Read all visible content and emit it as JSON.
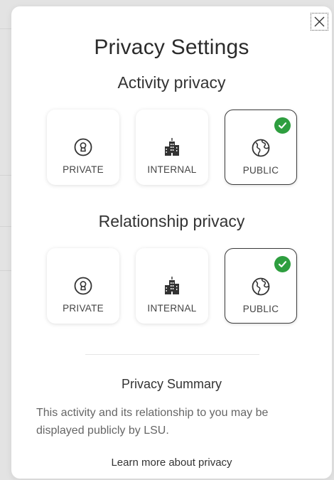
{
  "modal": {
    "title": "Privacy Settings"
  },
  "activity": {
    "heading": "Activity privacy",
    "options": [
      {
        "label": "PRIVATE",
        "icon": "keyhole-icon",
        "selected": false
      },
      {
        "label": "INTERNAL",
        "icon": "building-icon",
        "selected": false
      },
      {
        "label": "PUBLIC",
        "icon": "globe-icon",
        "selected": true
      }
    ]
  },
  "relationship": {
    "heading": "Relationship privacy",
    "options": [
      {
        "label": "PRIVATE",
        "icon": "keyhole-icon",
        "selected": false
      },
      {
        "label": "INTERNAL",
        "icon": "building-icon",
        "selected": false
      },
      {
        "label": "PUBLIC",
        "icon": "globe-icon",
        "selected": true
      }
    ]
  },
  "summary": {
    "title": "Privacy Summary",
    "text": "This activity and its relationship to you may be displayed publicly by LSU.",
    "learn_more": "Learn more about privacy"
  },
  "colors": {
    "check": "#2e9e3f",
    "selected_border": "#3c3c3c",
    "text": "#333333"
  }
}
